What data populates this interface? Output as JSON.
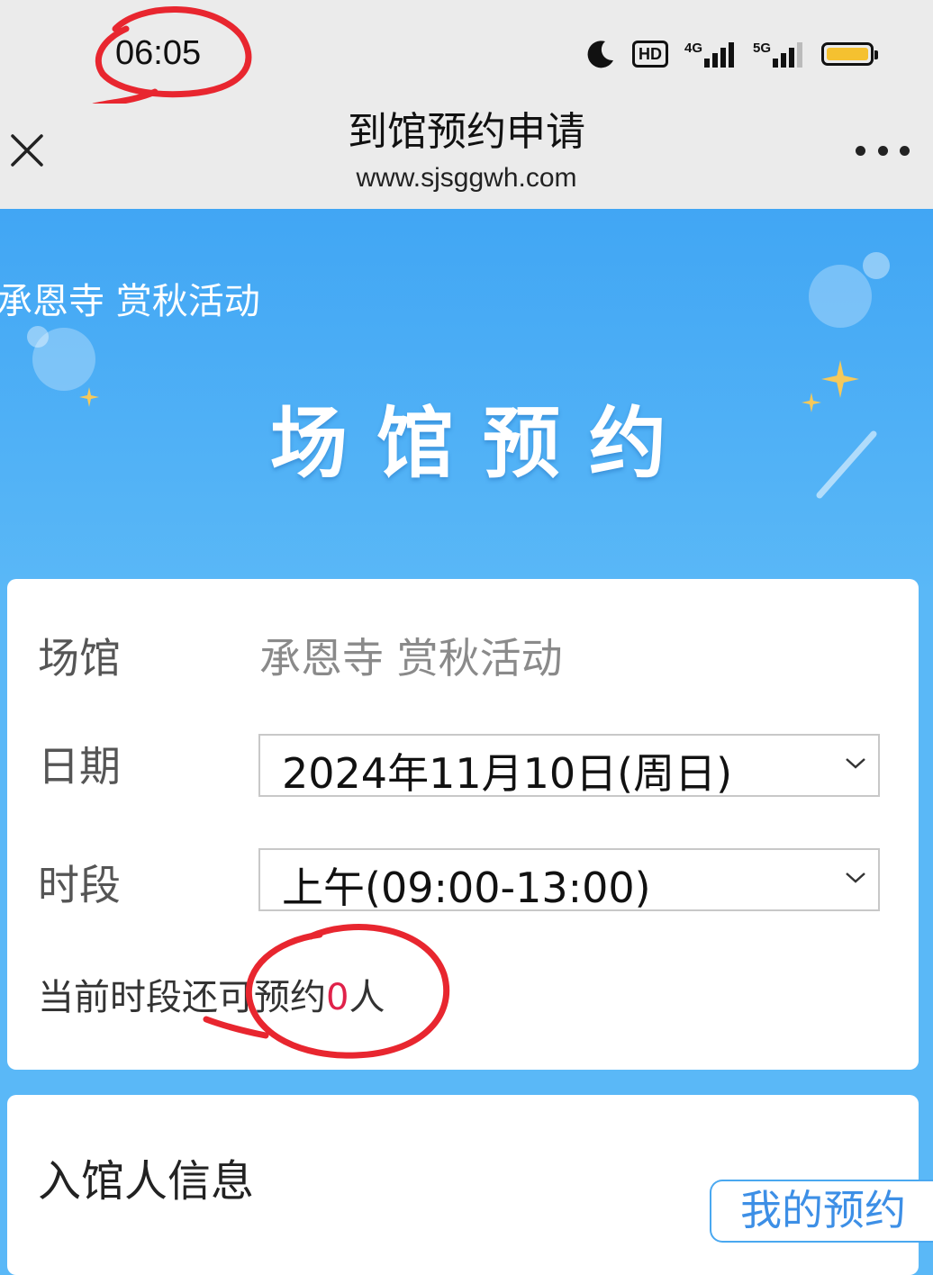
{
  "status_bar": {
    "time": "06:05",
    "icons": [
      "moon-icon",
      "hd-icon",
      "signal-4g-icon",
      "signal-5g-icon",
      "battery-icon"
    ],
    "hd_label": "HD",
    "net_4g": "4G",
    "net_5g": "5G"
  },
  "nav": {
    "title": "到馆预约申请",
    "url": "www.sjsggwh.com"
  },
  "banner": {
    "venue": "承恩寺 赏秋活动",
    "title": "场馆预约"
  },
  "form": {
    "venue_label": "场馆",
    "venue_value": "承恩寺 赏秋活动",
    "date_label": "日期",
    "date_value": "2024年11月10日(周日)",
    "slot_label": "时段",
    "slot_value": "上午(09:00-13:00)",
    "remaining_prefix": "当前时段还可预约",
    "remaining_count": "0",
    "remaining_suffix": "人"
  },
  "visitor_section": {
    "title": "入馆人信息"
  },
  "floating": {
    "my_booking": "我的预约"
  },
  "colors": {
    "banner_blue": "#41a6f4",
    "accent_red": "#e0224a",
    "link_blue": "#3d8fe6",
    "annotation_red": "#e8262f"
  }
}
